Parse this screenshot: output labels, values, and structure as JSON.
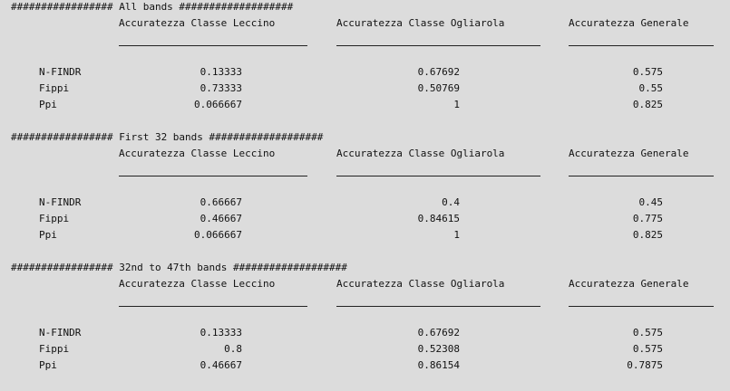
{
  "sections": [
    {
      "header": "################# All bands ###################",
      "columns": [
        "Accuratezza Classe Leccino",
        "Accuratezza Classe Ogliarola",
        "Accuratezza Generale"
      ],
      "rows": [
        {
          "label": "N-FINDR",
          "values": [
            "0.13333",
            "0.67692",
            "0.575"
          ]
        },
        {
          "label": "Fippi",
          "values": [
            "0.73333",
            "0.50769",
            "0.55"
          ]
        },
        {
          "label": "Ppi",
          "values": [
            "0.066667",
            "1",
            "0.825"
          ]
        }
      ]
    },
    {
      "header": "################# First 32 bands ###################",
      "columns": [
        "Accuratezza Classe Leccino",
        "Accuratezza Classe Ogliarola",
        "Accuratezza Generale"
      ],
      "rows": [
        {
          "label": "N-FINDR",
          "values": [
            "0.66667",
            "0.4",
            "0.45"
          ]
        },
        {
          "label": "Fippi",
          "values": [
            "0.46667",
            "0.84615",
            "0.775"
          ]
        },
        {
          "label": "Ppi",
          "values": [
            "0.066667",
            "1",
            "0.825"
          ]
        }
      ]
    },
    {
      "header": "################# 32nd to 47th bands ###################",
      "columns": [
        "Accuratezza Classe Leccino",
        "Accuratezza Classe Ogliarola",
        "Accuratezza Generale"
      ],
      "rows": [
        {
          "label": "N-FINDR",
          "values": [
            "0.13333",
            "0.67692",
            "0.575"
          ]
        },
        {
          "label": "Fippi",
          "values": [
            "0.8",
            "0.52308",
            "0.575"
          ]
        },
        {
          "label": "Ppi",
          "values": [
            "0.46667",
            "0.86154",
            "0.7875"
          ]
        }
      ]
    }
  ]
}
